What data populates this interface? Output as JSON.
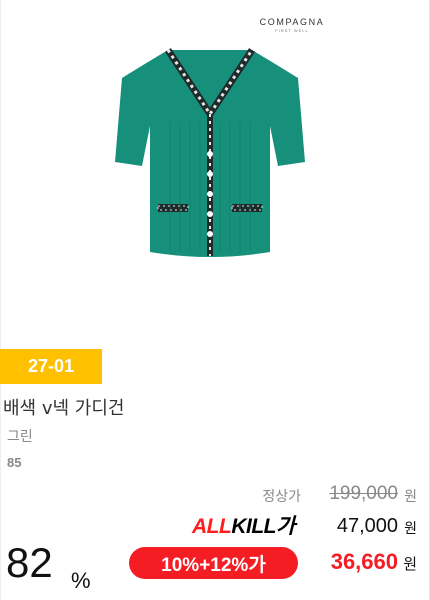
{
  "brand": {
    "name": "COMPAGNA",
    "sub": "FIRST WELL"
  },
  "product": {
    "image": "green-v-neck-cardigan",
    "badge": "27-01",
    "title": "배색 v넥 가디건",
    "color": "그린",
    "size": "85"
  },
  "pricing": {
    "regular_label": "정상가",
    "regular_price": "199,000",
    "allkill_brand_a": "ALL",
    "allkill_brand_b": "KILL",
    "allkill_brand_c": "가",
    "allkill_price": "47,000",
    "won": "원",
    "discount_number": "82",
    "discount_symbol": "%",
    "coupon_label": "10%+12%가",
    "final_price": "36,660"
  },
  "colors": {
    "badge": "#ffc000",
    "accent": "#f51d24",
    "cardigan": "#16907b"
  }
}
